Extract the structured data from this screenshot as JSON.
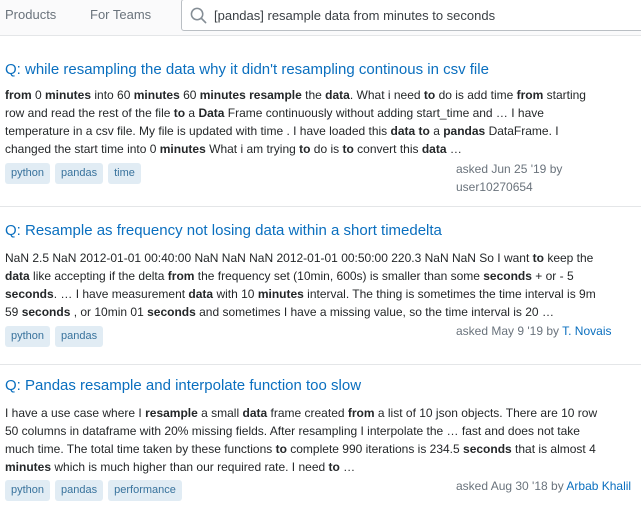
{
  "nav": {
    "products": "Products",
    "for_teams": "For Teams"
  },
  "search": {
    "query": "[pandas] resample data from minutes to seconds"
  },
  "results": [
    {
      "title": "Q: while resampling the data why it didn't resampling continous in csv file",
      "excerpt": [
        [
          [
            "b",
            "from "
          ],
          [
            "t",
            "0 "
          ],
          [
            "b",
            "minutes"
          ],
          [
            "t",
            " into 60 "
          ],
          [
            "b",
            "minutes"
          ],
          [
            "t",
            " 60 "
          ],
          [
            "b",
            "minutes resample"
          ],
          [
            "t",
            " the "
          ],
          [
            "b",
            "data"
          ],
          [
            "t",
            ". What i need "
          ],
          [
            "b",
            "to"
          ],
          [
            "t",
            " do is add time "
          ],
          [
            "b",
            "from"
          ],
          [
            "t",
            " starting"
          ]
        ],
        [
          [
            "t",
            "row and read the rest of the file "
          ],
          [
            "b",
            "to"
          ],
          [
            "t",
            " a "
          ],
          [
            "b",
            "Data"
          ],
          [
            "t",
            " Frame continuously without adding start_time and … I have"
          ]
        ],
        [
          [
            "t",
            "temperature in a csv file. My file is updated with time . I have loaded this "
          ],
          [
            "b",
            "data to"
          ],
          [
            "t",
            " a "
          ],
          [
            "b",
            "pandas"
          ],
          [
            "t",
            " DataFrame. I"
          ]
        ],
        [
          [
            "t",
            "changed the start time into 0 "
          ],
          [
            "b",
            "minutes"
          ],
          [
            "t",
            " What i am trying "
          ],
          [
            "b",
            "to"
          ],
          [
            "t",
            " do is "
          ],
          [
            "b",
            "to"
          ],
          [
            "t",
            " convert this "
          ],
          [
            "b",
            "data"
          ],
          [
            "t",
            " …"
          ]
        ]
      ],
      "tags": [
        "python",
        "pandas",
        "time"
      ],
      "asked": "asked Jun 25 '19 by",
      "user": "user10270654"
    },
    {
      "title": "Q: Resample as frequency not losing data within a short timedelta",
      "excerpt": [
        [
          [
            "t",
            "NaN 2.5 NaN 2012-01-01 00:40:00 NaN NaN NaN 2012-01-01 00:50:00 220.3 NaN NaN So I want "
          ],
          [
            "b",
            "to"
          ],
          [
            "t",
            " keep the"
          ]
        ],
        [
          [
            "b",
            "data"
          ],
          [
            "t",
            " like accepting if the delta "
          ],
          [
            "b",
            "from"
          ],
          [
            "t",
            " the frequency set (10min, 600s) is smaller than some "
          ],
          [
            "b",
            "seconds"
          ],
          [
            "t",
            " + or - 5"
          ]
        ],
        [
          [
            "b",
            "seconds"
          ],
          [
            "t",
            ". … I have measurement "
          ],
          [
            "b",
            "data"
          ],
          [
            "t",
            " with 10 "
          ],
          [
            "b",
            "minutes"
          ],
          [
            "t",
            " interval. The thing is sometimes the time interval is 9m"
          ]
        ],
        [
          [
            "t",
            "59 "
          ],
          [
            "b",
            "seconds"
          ],
          [
            "t",
            " , or 10min 01 "
          ],
          [
            "b",
            "seconds"
          ],
          [
            "t",
            " and sometimes I have a missing value, so the time interval is 20 …"
          ]
        ]
      ],
      "tags": [
        "python",
        "pandas"
      ],
      "asked": "asked May 9 '19 by",
      "user": "T. Novais"
    },
    {
      "title": "Q: Pandas resample and interpolate function too slow",
      "excerpt": [
        [
          [
            "t",
            "I have a use case where I "
          ],
          [
            "b",
            "resample"
          ],
          [
            "t",
            " a small "
          ],
          [
            "b",
            "data"
          ],
          [
            "t",
            " frame created "
          ],
          [
            "b",
            "from"
          ],
          [
            "t",
            " a list of 10 json objects. There are 10 row"
          ]
        ],
        [
          [
            "t",
            "50 columns in dataframe with 20% missing fields. After resampling I interpolate the … fast and does not take"
          ]
        ],
        [
          [
            "t",
            "much time. The total time taken by these functions "
          ],
          [
            "b",
            "to"
          ],
          [
            "t",
            " complete 990 iterations is 234.5 "
          ],
          [
            "b",
            "seconds"
          ],
          [
            "t",
            " that is almost 4"
          ]
        ],
        [
          [
            "b",
            "minutes"
          ],
          [
            "t",
            " which is much higher than our required rate. I need "
          ],
          [
            "b",
            "to"
          ],
          [
            "t",
            " …"
          ]
        ]
      ],
      "tags": [
        "python",
        "pandas",
        "performance"
      ],
      "asked": "asked Aug 30 '18 by",
      "user": "Arbab Khalil"
    }
  ]
}
